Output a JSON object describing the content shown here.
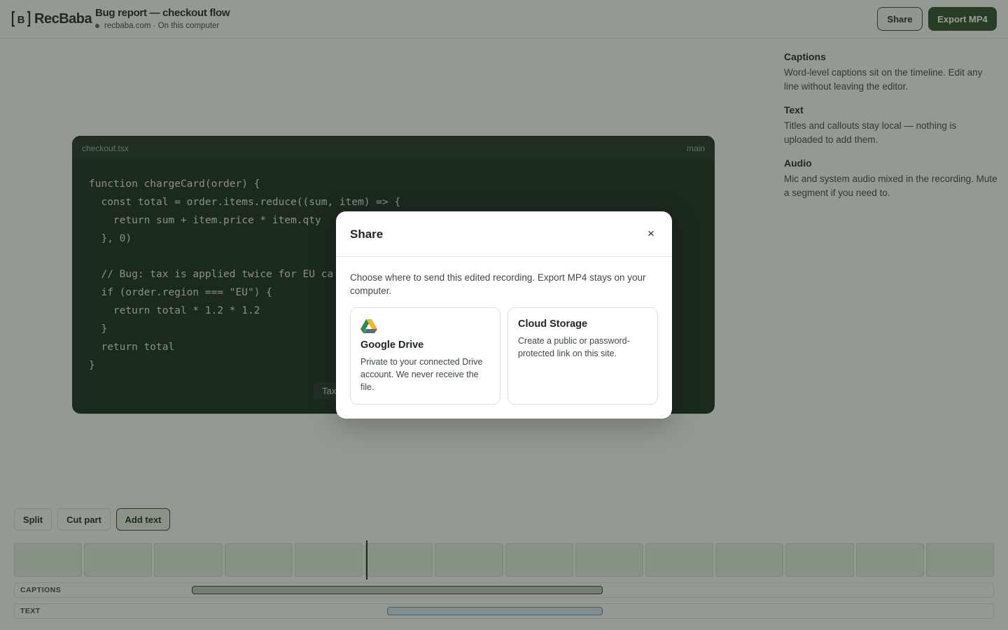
{
  "app": {
    "brand": "RecBaba",
    "title": "Bug report — checkout flow",
    "subtitle": "recbaba.com · On this computer",
    "status_color": "#3f7d3f"
  },
  "header": {
    "share_label": "Share",
    "export_label": "Export MP4"
  },
  "preview": {
    "filename": "checkout.tsx",
    "branch": "main",
    "code_lines": [
      "function chargeCard(order) {",
      "  const total = order.items.reduce((sum, item) => {",
      "    return sum + item.price * item.qty",
      "  }, 0)",
      "",
      "  // Bug: tax is applied twice for EU ca",
      "  if (order.region === \"EU\") {",
      "    return total * 1.2 * 1.2",
      "  }",
      "  return total",
      "}"
    ],
    "caption_fragment": "Tax"
  },
  "panel": {
    "features": [
      {
        "title": "Captions",
        "desc": "Word-level captions sit on the timeline. Edit any line without leaving the editor."
      },
      {
        "title": "Text",
        "desc": "Titles and callouts stay local — nothing is uploaded to add them."
      },
      {
        "title": "Audio",
        "desc": "Mic and system audio mixed in the recording. Mute a segment if you need to."
      }
    ]
  },
  "toolbar": {
    "split_label": "Split",
    "cut_label": "Cut part",
    "add_text_label": "Add text"
  },
  "timeline": {
    "thumbnail_count": 14,
    "tracks": {
      "captions_label": "CAPTIONS",
      "text_label": "TEXT"
    }
  },
  "modal": {
    "title": "Share",
    "close_icon": "×",
    "description": "Choose where to send this edited recording. Export MP4 stays on your computer.",
    "options": [
      {
        "title": "Google Drive",
        "desc": "Private to your connected Drive account. We never receive the file.",
        "icon": "google-drive-icon"
      },
      {
        "title": "Cloud Storage",
        "desc": "Create a public or password-protected link on this site.",
        "icon": ""
      }
    ]
  },
  "colors": {
    "accent": "#2f4f31",
    "background": "#f5f7f2",
    "code_bg": "#1a2a1c"
  }
}
